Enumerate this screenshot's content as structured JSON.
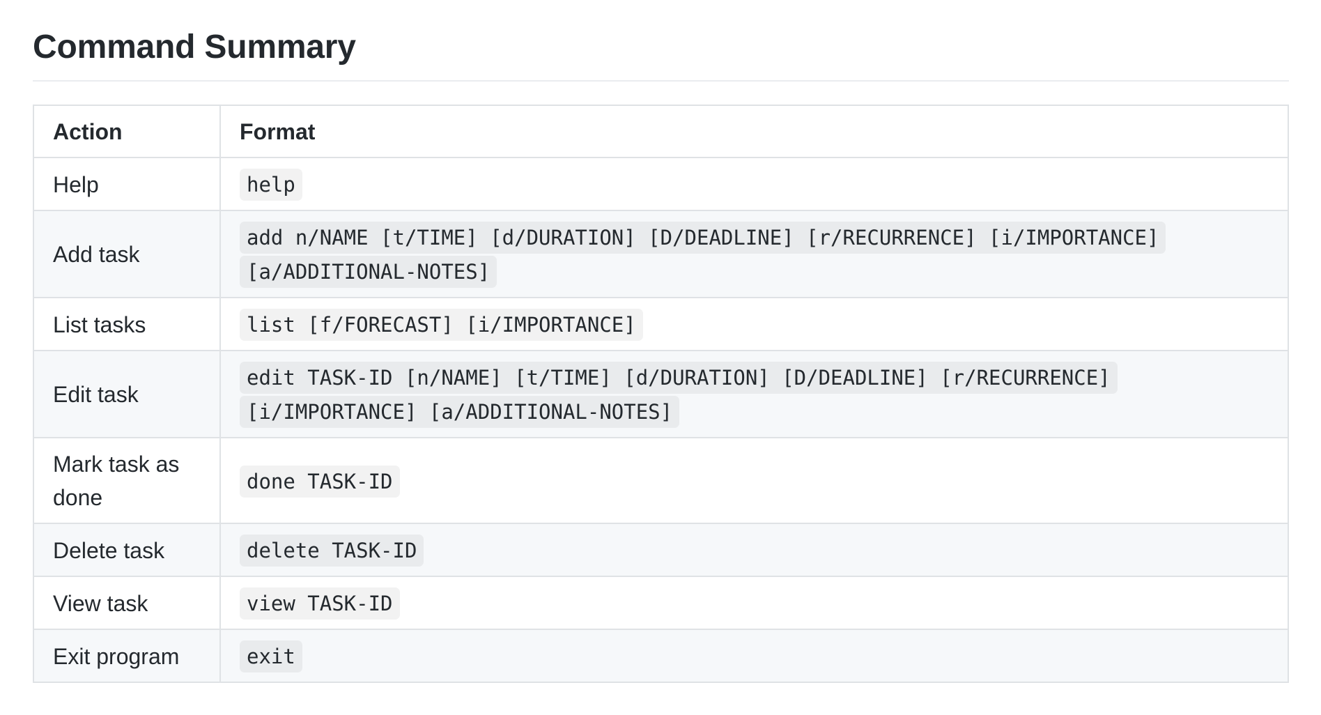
{
  "heading": "Command Summary",
  "table": {
    "headers": {
      "action": "Action",
      "format": "Format"
    },
    "rows": [
      {
        "action": "Help",
        "format": "help"
      },
      {
        "action": "Add task",
        "format": "add n/NAME [t/TIME] [d/DURATION] [D/DEADLINE] [r/RECURRENCE] [i/IMPORTANCE] [a/ADDITIONAL-NOTES]"
      },
      {
        "action": "List tasks",
        "format": "list [f/FORECAST] [i/IMPORTANCE]"
      },
      {
        "action": "Edit task",
        "format": "edit TASK-ID [n/NAME] [t/TIME] [d/DURATION] [D/DEADLINE] [r/RECURRENCE] [i/IMPORTANCE] [a/ADDITIONAL-NOTES]"
      },
      {
        "action": "Mark task as done",
        "format": "done TASK-ID"
      },
      {
        "action": "Delete task",
        "format": "delete TASK-ID"
      },
      {
        "action": "View task",
        "format": "view TASK-ID"
      },
      {
        "action": "Exit program",
        "format": "exit"
      }
    ]
  }
}
